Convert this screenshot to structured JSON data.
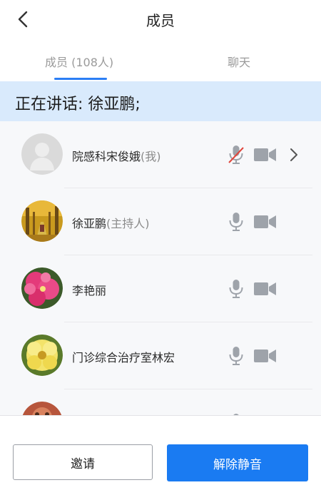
{
  "header": {
    "title": "成员"
  },
  "tabs": [
    {
      "label": "成员 (108人)",
      "active": true
    },
    {
      "label": "聊天",
      "active": false
    }
  ],
  "speaking": {
    "text": "正在讲话: 徐亚鹏;"
  },
  "members": [
    {
      "name": "院感科宋俊娥",
      "tag": "(我)",
      "avatar": "default-person",
      "mic": "muted",
      "camera": "off"
    },
    {
      "name": "徐亚鹏",
      "tag": "(主持人)",
      "avatar": "autumn-trees-photo",
      "mic": "on",
      "camera": "off"
    },
    {
      "name": "李艳丽",
      "tag": "",
      "avatar": "pink-flowers-photo",
      "mic": "on",
      "camera": "off"
    },
    {
      "name": "门诊综合治疗室林宏",
      "tag": "",
      "avatar": "yellow-flower-photo",
      "mic": "on",
      "camera": "off"
    },
    {
      "name": "",
      "tag": "",
      "avatar": "partially-visible",
      "mic": "on",
      "camera": "off"
    }
  ],
  "footer": {
    "invite": "邀请",
    "unmute": "解除静音"
  },
  "colors": {
    "accent": "#1a7bf2",
    "speaking_bg": "#d9eafc",
    "icon": "#9ea3aa",
    "muted_slash": "#e0453b"
  }
}
